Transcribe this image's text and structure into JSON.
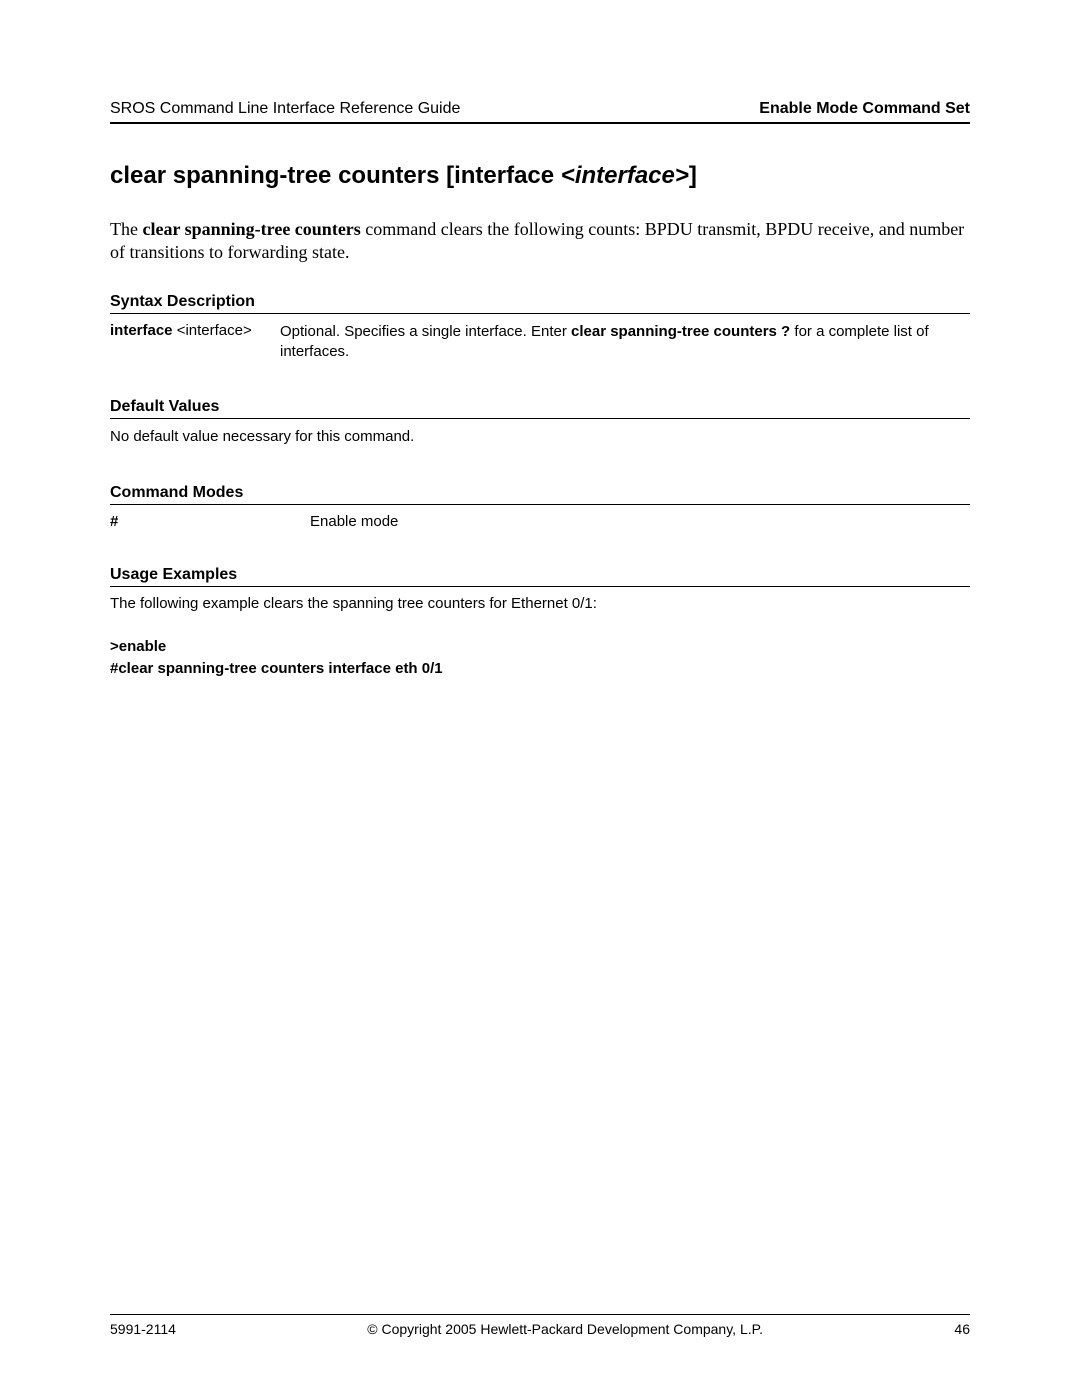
{
  "header": {
    "left": "SROS Command Line Interface Reference Guide",
    "right": "Enable Mode Command Set"
  },
  "title": {
    "cmd": "clear spanning-tree counters [interface ",
    "param": "<interface>",
    "close": "]"
  },
  "intro": {
    "pre": "The ",
    "bold": "clear spanning-tree counters",
    "post": " command clears the following counts: BPDU transmit, BPDU receive, and number of transitions to forwarding state."
  },
  "sections": {
    "syntax_head": "Syntax Description",
    "syntax": {
      "left_kw": "interface",
      "left_param": " <interface>",
      "desc_pre": "Optional. Specifies a single interface. Enter ",
      "desc_bold": "clear spanning-tree counters ?",
      "desc_post": " for a complete list of interfaces."
    },
    "defaults_head": "Default Values",
    "defaults_text": "No default value necessary for this command.",
    "modes_head": "Command Modes",
    "modes": {
      "symbol": "#",
      "name": "Enable mode"
    },
    "usage_head": "Usage Examples",
    "usage_intro": "The following example clears the spanning tree counters for Ethernet 0/1:",
    "usage_code_l1": ">enable",
    "usage_code_l2": "#clear spanning-tree counters interface eth 0/1"
  },
  "footer": {
    "left": "5991-2114",
    "center": "© Copyright 2005 Hewlett-Packard Development Company, L.P.",
    "right": "46"
  }
}
